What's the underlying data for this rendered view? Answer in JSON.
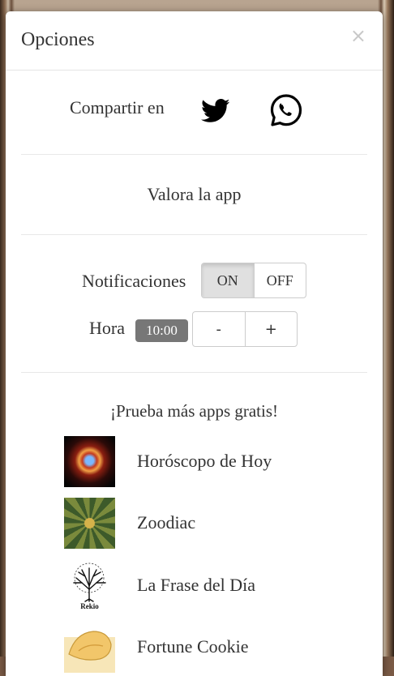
{
  "modal": {
    "title": "Opciones",
    "close": "×"
  },
  "share": {
    "label": "Compartir en",
    "icons": [
      "twitter-icon",
      "whatsapp-icon"
    ]
  },
  "rate": {
    "label": "Valora la app"
  },
  "notifications": {
    "label": "Notificaciones",
    "on": "ON",
    "off": "OFF",
    "selected": "ON"
  },
  "time": {
    "label": "Hora",
    "value": "10:00",
    "minus": "-",
    "plus": "+"
  },
  "apps": {
    "title": "¡Prueba más apps gratis!",
    "items": [
      {
        "name": "Horóscopo de Hoy"
      },
      {
        "name": "Zoodiac"
      },
      {
        "name": "La Frase del Día",
        "thumb_caption": "Rekio"
      },
      {
        "name": "Fortune Cookie"
      }
    ]
  },
  "colors": {
    "badge": "#777777",
    "toggle_active": "#e0e0e0"
  }
}
